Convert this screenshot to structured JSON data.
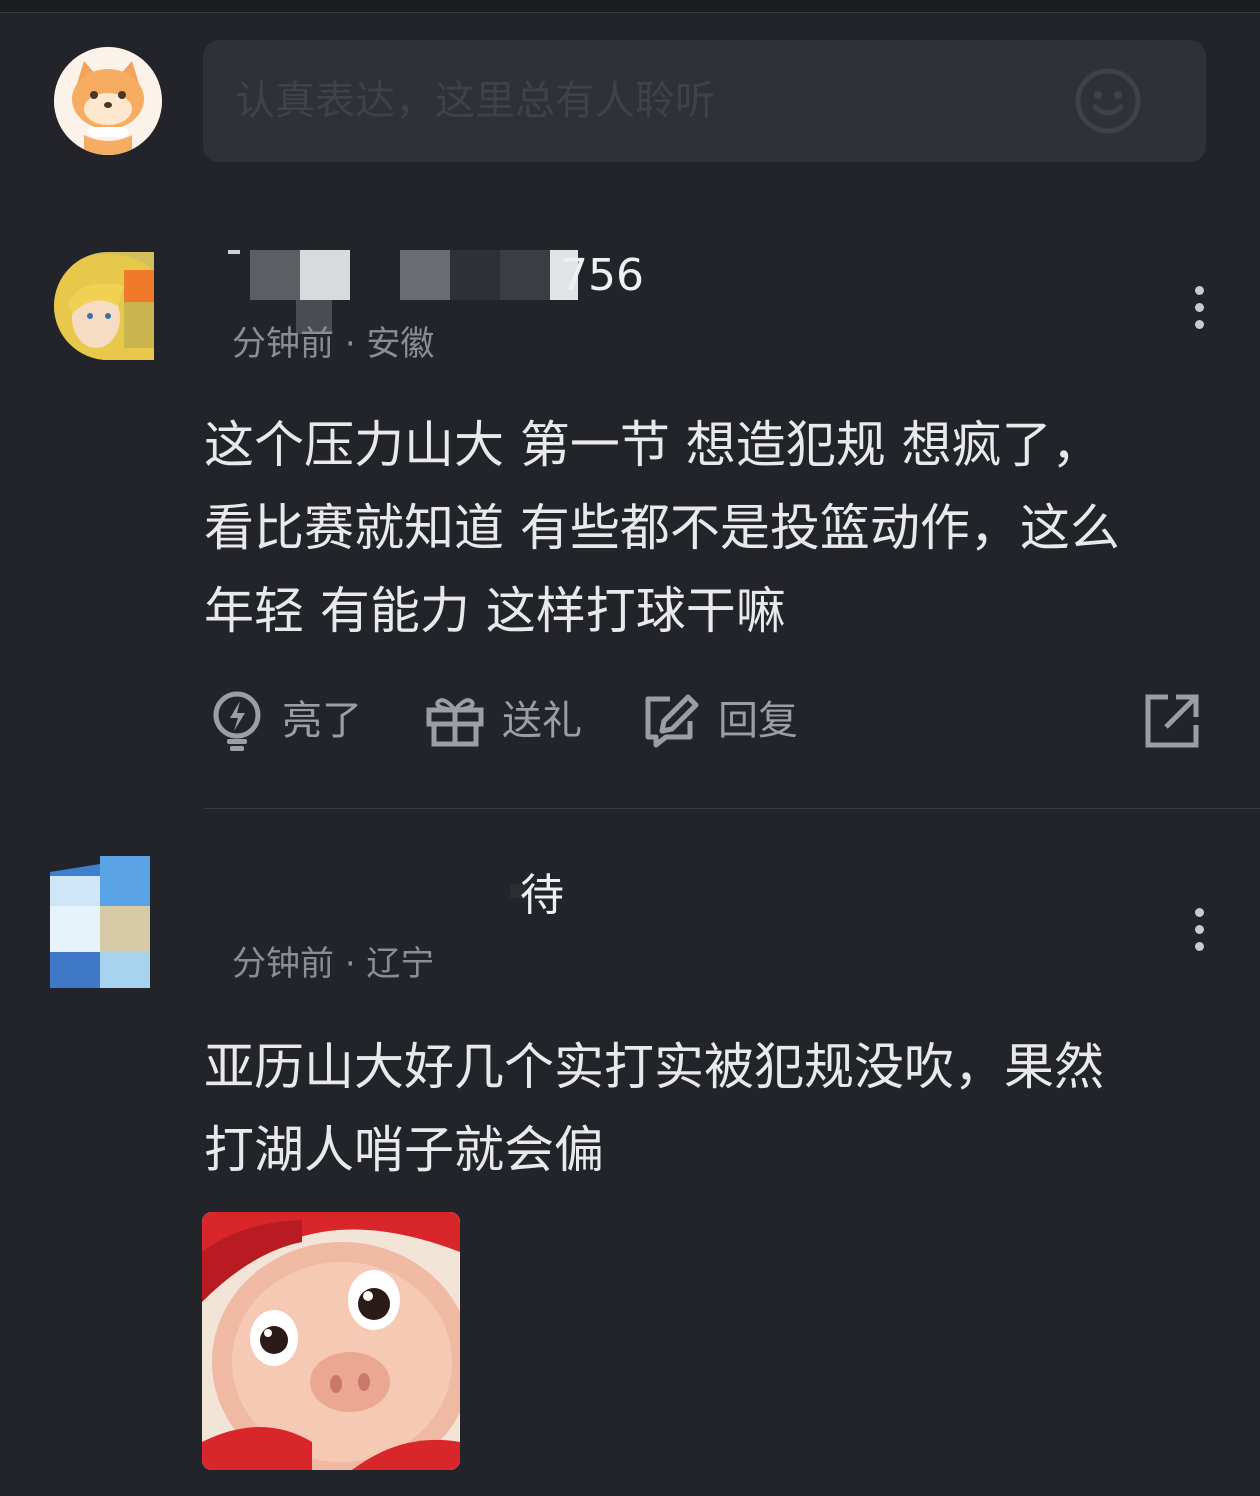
{
  "composer": {
    "placeholder": "认真表达，这里总有人聆听",
    "avatar_icon": "fox-avatar-icon",
    "emoji_icon": "smile-icon"
  },
  "comments": [
    {
      "username_visible": "756",
      "time": "分钟前",
      "location": "· 安徽",
      "text": "这个压力山大 第一节 想造犯规 想疯了，\n看比赛就知道 有些都不是投篮动作，这么\n年轻 有能力 这样打球干嘛",
      "actions": {
        "like_label": "亮了",
        "gift_label": "送礼",
        "reply_label": "回复"
      }
    },
    {
      "username_visible": "待",
      "time": "分钟前",
      "location": "· 辽宁",
      "text": "亚历山大好几个实打实被犯规没吹，果然\n打湖人哨子就会偏"
    }
  ],
  "colors": {
    "background": "#232429",
    "input_bg": "#2f3138",
    "text": "#e8e9ec",
    "muted": "#8a8d96",
    "icon": "#9b9ea7"
  }
}
